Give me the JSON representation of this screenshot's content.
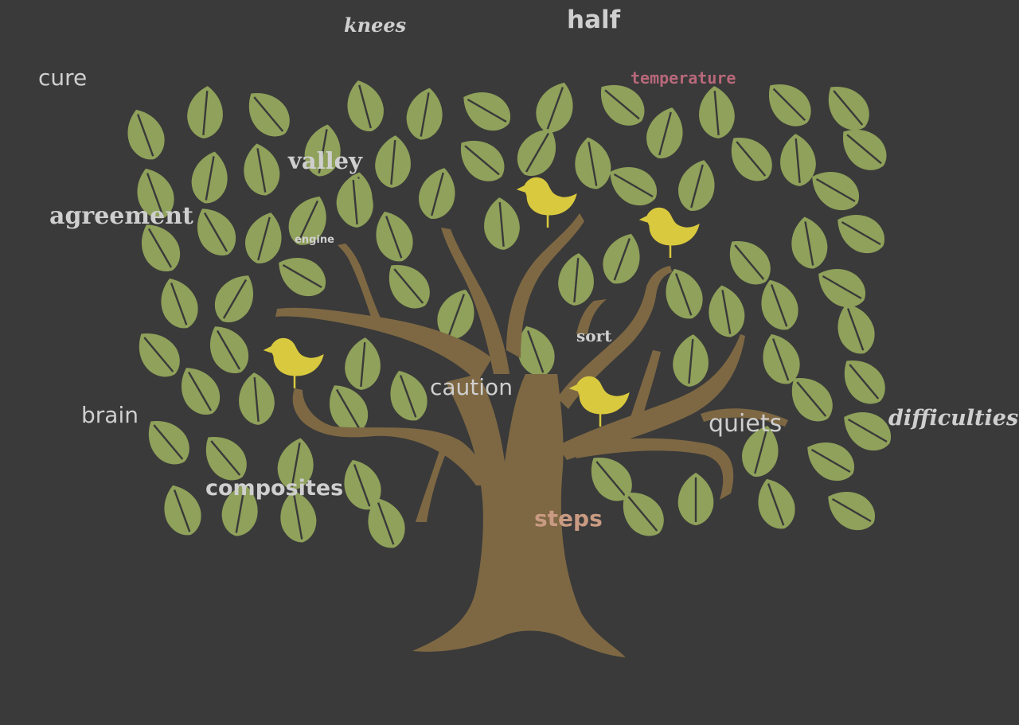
{
  "colors": {
    "background": "#3a3a3a",
    "trunk": "#7e6843",
    "leaf": "#8fa15a",
    "leaf_vein": "#3a3a3a",
    "bird": "#d9c93e",
    "word_default": "#cfcfcf",
    "word_pink": "#b8687a",
    "word_tan": "#c99a82"
  },
  "words": {
    "knees": "knees",
    "half": "half",
    "cure": "cure",
    "temperature": "temperature",
    "valley": "valley",
    "agreement": "agreement",
    "engine": "engine",
    "sort": "sort",
    "caution": "caution",
    "brain": "brain",
    "quiets": "quiets",
    "difficulties": "difficulties",
    "composites": "composites",
    "steps": "steps"
  },
  "icons": {
    "tree": "tree-icon",
    "leaf": "leaf-icon",
    "bird": "bird-icon"
  }
}
